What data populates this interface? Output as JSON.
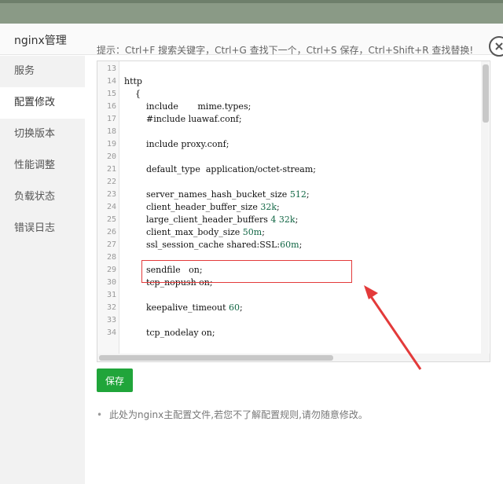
{
  "dialog": {
    "title": "nginx管理"
  },
  "sidebar": {
    "items": [
      {
        "label": "服务",
        "active": false
      },
      {
        "label": "配置修改",
        "active": true
      },
      {
        "label": "切换版本",
        "active": false
      },
      {
        "label": "性能调整",
        "active": false
      },
      {
        "label": "负载状态",
        "active": false
      },
      {
        "label": "错误日志",
        "active": false
      }
    ]
  },
  "hint": "提示：Ctrl+F 搜索关键字，Ctrl+G 查找下一个，Ctrl+S 保存，Ctrl+Shift+R 查找替换!",
  "editor": {
    "lines": [
      {
        "n": "13",
        "t": ""
      },
      {
        "n": "14",
        "t": "http"
      },
      {
        "n": "15",
        "t": "    {"
      },
      {
        "n": "16",
        "t": "        include       mime.types;"
      },
      {
        "n": "17",
        "t": "        #include luawaf.conf;"
      },
      {
        "n": "18",
        "t": ""
      },
      {
        "n": "19",
        "t": "        include proxy.conf;"
      },
      {
        "n": "20",
        "t": ""
      },
      {
        "n": "21",
        "t": "        default_type  application/octet-stream;"
      },
      {
        "n": "22",
        "t": ""
      },
      {
        "n": "23",
        "t": "        server_names_hash_bucket_size 512;"
      },
      {
        "n": "24",
        "t": "        client_header_buffer_size 32k;"
      },
      {
        "n": "25",
        "t": "        large_client_header_buffers 4 32k;"
      },
      {
        "n": "26",
        "t": "        client_max_body_size 50m;"
      },
      {
        "n": "27",
        "t": "        ssl_session_cache shared:SSL:60m;"
      },
      {
        "n": "28",
        "t": ""
      },
      {
        "n": "29",
        "t": "        sendfile   on;"
      },
      {
        "n": "30",
        "t": "        tcp_nopush on;"
      },
      {
        "n": "31",
        "t": ""
      },
      {
        "n": "32",
        "t": "        keepalive_timeout 60;"
      },
      {
        "n": "33",
        "t": ""
      },
      {
        "n": "34",
        "t": "        tcp_nodelay on;"
      }
    ],
    "highlighted_line": "27"
  },
  "buttons": {
    "save": "保存"
  },
  "note": "此处为nginx主配置文件,若您不了解配置规则,请勿随意修改。",
  "colors": {
    "accent": "#20a53a",
    "annotation": "#e33a3a",
    "number": "#116644"
  }
}
